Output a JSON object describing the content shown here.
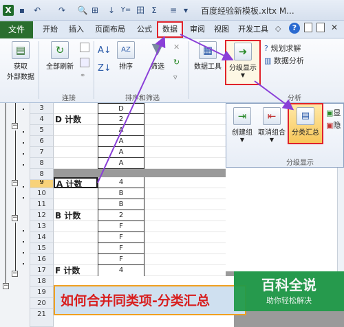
{
  "window": {
    "title": "百度经验新模板.xltx M..."
  },
  "quick_access": {
    "icons": [
      "excel-logo-icon",
      "save-icon",
      "undo-icon",
      "redo-icon",
      "print-preview-icon",
      "format-icon",
      "sort-icon",
      "filter-icon",
      "borders-icon",
      "sum-icon",
      "align-icon",
      "dropdown-icon"
    ],
    "glyphs": [
      "X",
      "▪",
      "↶",
      "↷",
      "🔍",
      "⊞",
      "↓",
      "Y=",
      "田",
      "Σ",
      "≡",
      "▾"
    ]
  },
  "tabs": {
    "file": "文件",
    "items": [
      "开始",
      "插入",
      "页面布局",
      "公式",
      "数据",
      "审阅",
      "视图",
      "开发工具"
    ]
  },
  "ribbon": {
    "get_external": "获取\n外部数据",
    "get_external_l1": "获取",
    "get_external_l2": "外部数据",
    "refresh_all": "全部刷新",
    "sort": "排序",
    "filter": "筛选",
    "data_tools": "数据工具",
    "outline": "分级显示",
    "solver": "规划求解",
    "analysis": "数据分析",
    "group_connections": "连接",
    "group_sort_filter": "排序和筛选",
    "group_analysis": "分析"
  },
  "outline_popup": {
    "group": "创建组",
    "ungroup": "取消组合",
    "subtotal": "分类汇总",
    "show": "显",
    "hide": "隐",
    "caption": "分级显示"
  },
  "rows": [
    {
      "num": "3",
      "a": "",
      "b": "D"
    },
    {
      "num": "4",
      "a": "D 计数",
      "b": "2"
    },
    {
      "num": "5",
      "a": "",
      "b": "A"
    },
    {
      "num": "6",
      "a": "",
      "b": "A"
    },
    {
      "num": "7",
      "a": "",
      "b": "A"
    },
    {
      "num": "8",
      "a": "",
      "b": "A"
    },
    {
      "num": "9",
      "a": "A 计数",
      "b": "4"
    },
    {
      "num": "10",
      "a": "",
      "b": "B"
    },
    {
      "num": "11",
      "a": "",
      "b": "B"
    },
    {
      "num": "12",
      "a": "B 计数",
      "b": "2"
    },
    {
      "num": "13",
      "a": "",
      "b": "F"
    },
    {
      "num": "14",
      "a": "",
      "b": "F"
    },
    {
      "num": "15",
      "a": "",
      "b": "F"
    },
    {
      "num": "16",
      "a": "",
      "b": "F"
    },
    {
      "num": "17",
      "a": "F 计数",
      "b": "4"
    },
    {
      "num": "18",
      "a": "",
      "b": ""
    },
    {
      "num": "19",
      "a": "",
      "b": ""
    },
    {
      "num": "20",
      "a": "",
      "b": ""
    },
    {
      "num": "21",
      "a": "",
      "b": ""
    }
  ],
  "banner": {
    "text": "如何合并同类项-分类汇总"
  },
  "watermark": {
    "title": "百科全说",
    "subtitle": "助你轻松解决"
  },
  "colors": {
    "accent_red": "#e0222a",
    "arrow_purple": "#8a3fd8",
    "file_green": "#2a6e2e",
    "selected_row": "#f8d27a"
  }
}
